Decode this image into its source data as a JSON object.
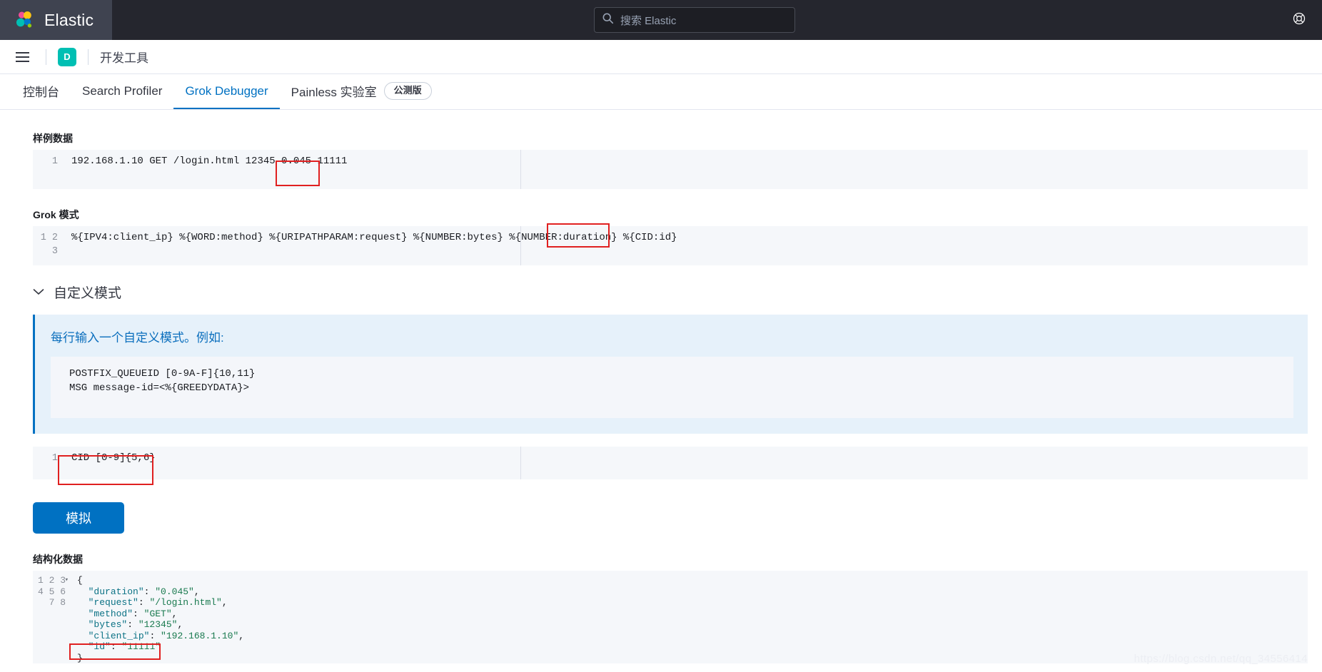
{
  "topbar": {
    "brand_name": "Elastic",
    "logo_icon": "elastic-logo-icon",
    "search": {
      "icon": "search-icon",
      "placeholder": "搜索 Elastic",
      "value": ""
    },
    "help_icon": "help-lifebuoy-icon"
  },
  "appbar": {
    "menu_icon": "hamburger-menu-icon",
    "space_badge": "D",
    "app_title": "开发工具"
  },
  "tabs": [
    {
      "label": "控制台",
      "active": false,
      "badge": null
    },
    {
      "label": "Search Profiler",
      "active": false,
      "badge": null
    },
    {
      "label": "Grok Debugger",
      "active": true,
      "badge": null
    },
    {
      "label": "Painless 实验室",
      "active": false,
      "badge": "公测版"
    }
  ],
  "sample_data": {
    "label": "样例数据",
    "line_numbers": [
      "1"
    ],
    "value": "192.168.1.10 GET /login.html 12345 0.045 11111",
    "highlight": "11111"
  },
  "grok_pattern": {
    "label": "Grok 模式",
    "line_numbers": [
      "1",
      "2",
      "3"
    ],
    "value": "%{IPV4:client_ip} %{WORD:method} %{URIPATHPARAM:request} %{NUMBER:bytes} %{NUMBER:duration} %{CID:id}",
    "highlight": "%{CID:id}"
  },
  "custom_patterns": {
    "accordion_label": "自定义模式",
    "chevron_icon": "chevron-down-icon",
    "expanded": true,
    "callout_title": "每行输入一个自定义模式。例如:",
    "callout_code": "POSTFIX_QUEUEID [0-9A-F]{10,11}\nMSG message-id=<%{GREEDYDATA}>",
    "line_numbers": [
      "1"
    ],
    "value": "CID [0-9]{5,6}",
    "highlight": "CID [0-9]{5,6}"
  },
  "simulate_button": {
    "label": "模拟"
  },
  "structured_data": {
    "label": "结构化数据",
    "line_numbers": [
      "1",
      "2",
      "3",
      "4",
      "5",
      "6",
      "7",
      "8"
    ],
    "fold_marker": "▾",
    "lines": [
      {
        "indent": 0,
        "text": "{"
      },
      {
        "indent": 1,
        "key": "\"duration\"",
        "value": "\"0.045\"",
        "tail": ","
      },
      {
        "indent": 1,
        "key": "\"request\"",
        "value": "\"/login.html\"",
        "tail": ","
      },
      {
        "indent": 1,
        "key": "\"method\"",
        "value": "\"GET\"",
        "tail": ","
      },
      {
        "indent": 1,
        "key": "\"bytes\"",
        "value": "\"12345\"",
        "tail": ","
      },
      {
        "indent": 1,
        "key": "\"client_ip\"",
        "value": "\"192.168.1.10\"",
        "tail": ","
      },
      {
        "indent": 1,
        "key": "\"id\"",
        "value": "\"11111\"",
        "tail": ""
      },
      {
        "indent": 0,
        "text": "}"
      }
    ],
    "highlight": "\"id\": \"11111\""
  },
  "watermark": "https://blog.csdn.net/qq_34556414",
  "colors": {
    "header_bg": "#25262e",
    "brand_bg": "#3f4350",
    "accent": "#0071c2",
    "space_badge": "#00bfb3",
    "highlight_box": "#e02020",
    "editor_bg": "#f5f7fa",
    "callout_bg": "#e6f1fa"
  }
}
